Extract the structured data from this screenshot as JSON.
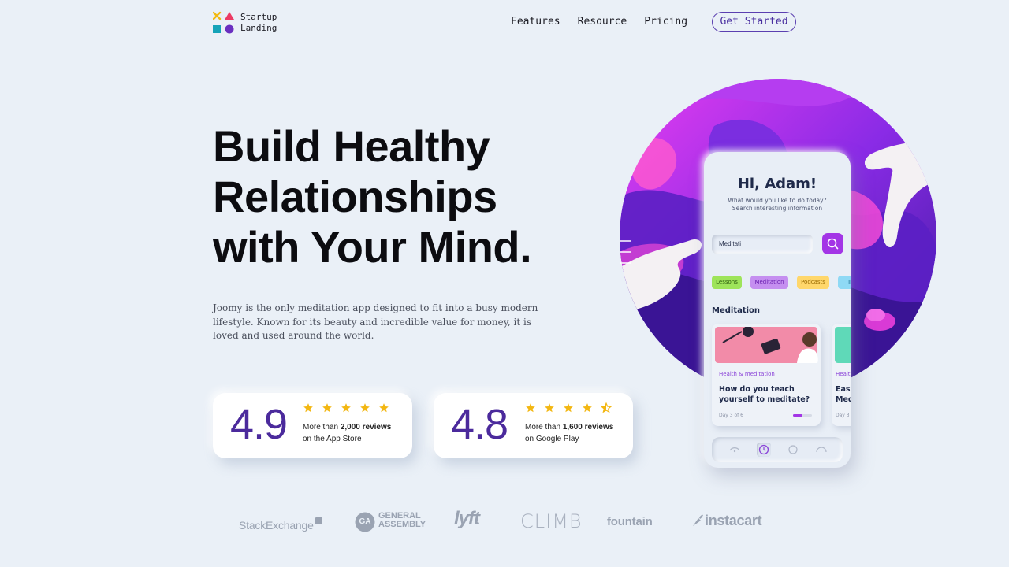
{
  "brand": {
    "line1": "Startup",
    "line2": "Landing"
  },
  "nav": {
    "links": [
      "Features",
      "Resource",
      "Pricing"
    ],
    "cta": "Get Started"
  },
  "hero": {
    "headline": [
      "Build Healthy",
      "Relationships",
      "with Your Mind."
    ],
    "description": "Joomy is the only meditation app designed to fit into a busy modern lifestyle. Known for its beauty and incredible value for money, it is loved and used around the world."
  },
  "ratings": [
    {
      "score": "4.9",
      "stars": 5,
      "count_prefix": "More than ",
      "count": "2,000 reviews",
      "store": "on the App Store"
    },
    {
      "score": "4.8",
      "stars": 4.5,
      "count_prefix": "More than ",
      "count": "1,600 reviews",
      "store": "on Google Play"
    }
  ],
  "partners": [
    "StackExchange",
    "GENERAL",
    "ASSEMBLY",
    "GA",
    "lyft",
    "CLIMB",
    "fountain",
    "instacart"
  ],
  "phone": {
    "greeting": "Hi, Adam!",
    "sub1": "What would you like to do today?",
    "sub2": "Search interesting information",
    "search_value": "Meditati",
    "chips": [
      "Lessons",
      "Meditation",
      "Podcasts",
      "Tr"
    ],
    "section_title": "Meditation",
    "cards": [
      {
        "category": "Health & meditation",
        "title": "How do you teach yourself to meditate?",
        "day": "Day 3 of 6",
        "progress": 0.5
      },
      {
        "category": "Healt",
        "title": "Easy Med",
        "day": "Day 3"
      }
    ]
  },
  "colors": {
    "accent": "#4b2a9c",
    "purple": "#a335e6",
    "star": "#f3b712",
    "background": "#eaf0f7"
  }
}
